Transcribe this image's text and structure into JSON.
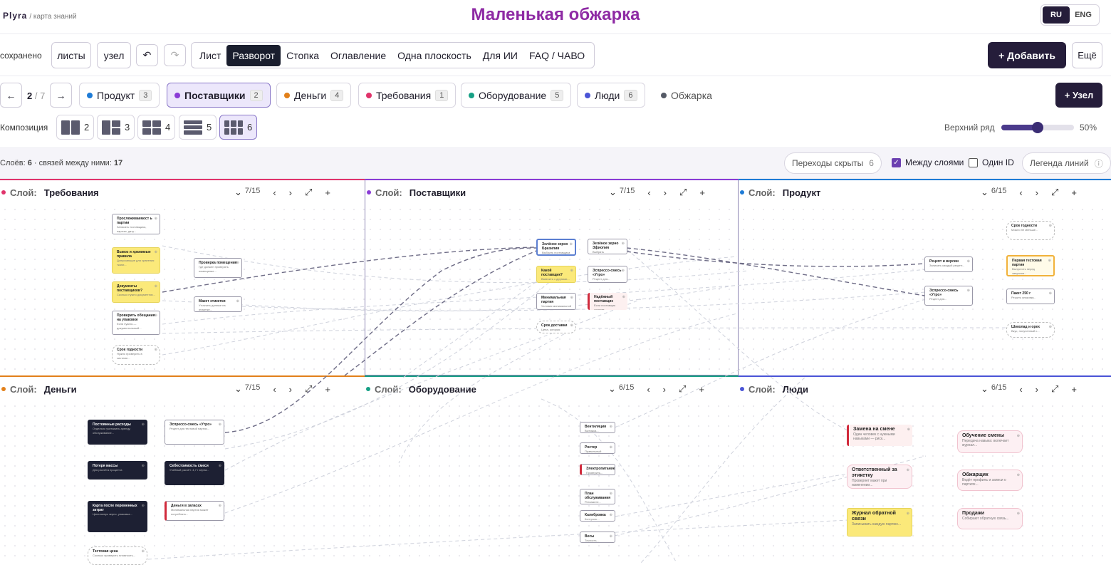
{
  "brand": {
    "name": "Plyra",
    "sub": "/ карта знаний"
  },
  "title": "Маленькая обжарка",
  "lang": {
    "active": "RU",
    "other": "ENG"
  },
  "toolbar": {
    "saved": "сохранено",
    "sheets": "листы",
    "node": "узел",
    "undo": "↶",
    "redo": "↷",
    "add": "+ Добавить",
    "more": "Ещё"
  },
  "modes": [
    "Лист",
    "Разворот",
    "Стопка",
    "Оглавление",
    "Одна плоскость",
    "Для ИИ",
    "FAQ / ЧАВО"
  ],
  "nav": {
    "prev": "←",
    "page": "2",
    "total": "/ 7",
    "next": "→",
    "add_node": "+ Узел"
  },
  "categories": [
    {
      "label": "Продукт",
      "count": "3",
      "color": "#1e7bd6"
    },
    {
      "label": "Поставщики",
      "count": "2",
      "color": "#8a3bd6"
    },
    {
      "label": "Деньги",
      "count": "4",
      "color": "#e2801a"
    },
    {
      "label": "Требования",
      "count": "1",
      "color": "#e0336b"
    },
    {
      "label": "Оборудование",
      "count": "5",
      "color": "#16a085"
    },
    {
      "label": "Люди",
      "count": "6",
      "color": "#4a54d6"
    },
    {
      "label": "Обжарка",
      "count": "",
      "color": "#555a66"
    }
  ],
  "composition": {
    "label": "Композиция",
    "options": [
      "2",
      "3",
      "4",
      "5",
      "6"
    ],
    "top_row_label": "Верхний ряд",
    "top_row_value": "50%",
    "top_row_fraction": 0.5
  },
  "info": {
    "layers_prefix": "Слоёв: ",
    "layers": "6",
    "links_prefix": " · связей между ними: ",
    "links": "17",
    "transitions": "Переходы скрыты",
    "transitions_count": "6",
    "between_layers": "Между слоями",
    "one_id": "Один ID",
    "legend": "Легенда линий"
  },
  "panel_label": "Слой:",
  "panels": [
    {
      "name": "Требования",
      "pos": "7/15",
      "color": "#e0336b"
    },
    {
      "name": "Поставщики",
      "pos": "7/15",
      "color": "#8a3bd6"
    },
    {
      "name": "Продукт",
      "pos": "6/15",
      "color": "#1e7bd6"
    },
    {
      "name": "Деньги",
      "pos": "7/15",
      "color": "#e2801a"
    },
    {
      "name": "Оборудование",
      "pos": "6/15",
      "color": "#16a085"
    },
    {
      "name": "Люди",
      "pos": "6/15",
      "color": "#4a54d6"
    }
  ],
  "nodes": {
    "req": [
      {
        "t": "Прослеживаемост ь партии",
        "s": "Записать поставщика, партию, дату..."
      },
      {
        "t": "Вывоз и хранимые правила",
        "s": "Допускающие для хранения ткани..."
      },
      {
        "t": "Проверка помещения",
        "s": "Где должен проверять помещение..."
      },
      {
        "t": "Документы поставщиков?",
        "s": "Сколько нужно документов..."
      },
      {
        "t": "Макет этикетки",
        "s": "Уточнить данные на этикетке..."
      },
      {
        "t": "Проверить обещания на упаковке",
        "s": "Если нужны — документальный..."
      },
      {
        "t": "Срок годности",
        "s": "Нужно проверить в системе..."
      }
    ],
    "sup": [
      {
        "t": "Зелёное зерно Бразилия",
        "s": "Выбрать поставщика для товара..."
      },
      {
        "t": "Зелёное зерно Эфиопия",
        "s": "Выбрать поставщика..."
      },
      {
        "t": "Эспрессо-смесь «Утро»",
        "s": "Рецепт для..."
      },
      {
        "t": "Какой поставщик?",
        "s": "Взвесить с другими..."
      },
      {
        "t": "Минимальная партия",
        "s": "Условия минимальной партии..."
      },
      {
        "t": "Надёжный поставщик",
        "s": "Если поставщик откажет..."
      },
      {
        "t": "Срок доставки",
        "s": "Цена, которая нужна..."
      }
    ],
    "prod": [
      {
        "t": "Срок годности",
        "s": "Можно не меньше..."
      },
      {
        "t": "Первая тестовая партия",
        "s": "Выпустить перед запуском..."
      },
      {
        "t": "Рецепт и версии",
        "s": "Записать каждый рецепт..."
      },
      {
        "t": "Эспрессо-смесь «Утро»",
        "s": "Рецепт для..."
      },
      {
        "t": "Пакет 250 г",
        "s": "Решить упаковку..."
      },
      {
        "t": "Шоколад и орех",
        "s": "Вкус, полученный с..."
      }
    ],
    "money": [
      {
        "t": "Постоянные расходы",
        "s": "Отдельно учитывать аренду, обслуживание..."
      },
      {
        "t": "Эспрессо-смесь «Утро»",
        "s": "Рецепт для тестовой партии..."
      },
      {
        "t": "Потеря массы",
        "s": "Для расчёта процента"
      },
      {
        "t": "Себестоимость смеси",
        "s": "Учебный расчёт: 4,7 г зерна..."
      },
      {
        "t": "Карта после переменных затрат",
        "s": "Цена минус зерно, упаковка..."
      },
      {
        "t": "Деньги в запасах",
        "s": "Минимальная партия может потреблять..."
      },
      {
        "t": "Тестовая цена",
        "s": "Сколько проверить готовность..."
      }
    ],
    "equip": [
      {
        "t": "Вентиляция",
        "s": "Вытяжка..."
      },
      {
        "t": "Ростер",
        "s": "Правильный выбор..."
      },
      {
        "t": "Электропитание",
        "s": "Проверить..."
      },
      {
        "t": "План обслуживания",
        "s": "Регламент..."
      },
      {
        "t": "Калибровка",
        "s": "Контроль..."
      },
      {
        "t": "Весы",
        "s": "Точность..."
      }
    ],
    "people": [
      {
        "t": "Замена на смене",
        "s": "Один человек с нужными навыками — риск..."
      },
      {
        "t": "Обучение смены",
        "s": "Передача навыка: включает журнал..."
      },
      {
        "t": "Ответственный за этикетку",
        "s": "Проверяет макет при изменении..."
      },
      {
        "t": "Обжарщик",
        "s": "Ведёт профиль и записи о партиях..."
      },
      {
        "t": "Журнал обратной связи",
        "s": "Записывать каждую партию..."
      },
      {
        "t": "Продажи",
        "s": "Собирают обратную связь..."
      }
    ]
  }
}
